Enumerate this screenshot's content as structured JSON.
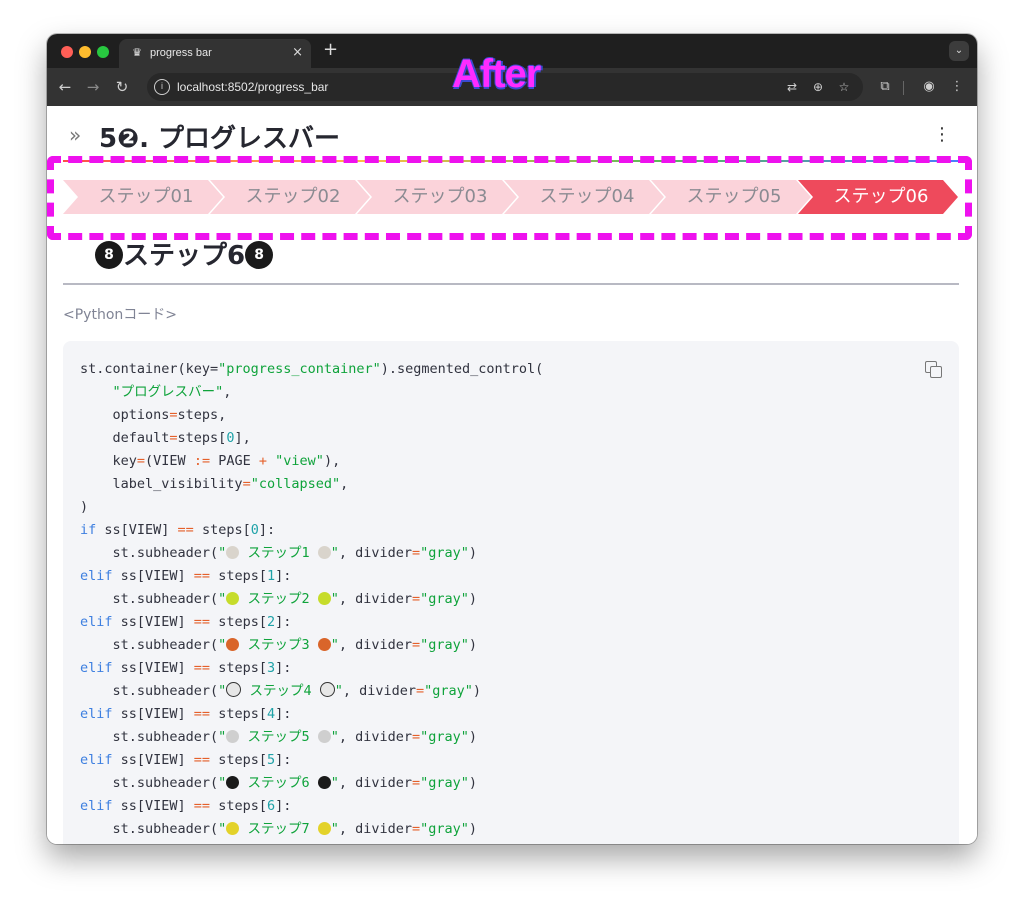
{
  "overlay": {
    "label": "After"
  },
  "browser": {
    "tab_title": "progress bar",
    "url": "localhost:8502/progress_bar"
  },
  "page": {
    "title": "5❷. プログレスバー",
    "steps": [
      "ステップ01",
      "ステップ02",
      "ステップ03",
      "ステップ04",
      "ステップ05",
      "ステップ06"
    ],
    "active_step_index": 5,
    "subheader_text": "ステップ6",
    "caption": "<Pythonコード>"
  },
  "code": {
    "lines": [
      "st.container(key=\"progress_container\").segmented_control(",
      "    \"プログレスバー\",",
      "    options=steps,",
      "    default=steps[0],",
      "    key=(VIEW := PAGE + \"view\"),",
      "    label_visibility=\"collapsed\",",
      ")",
      "if ss[VIEW] == steps[0]:",
      "    st.subheader(\"⚾ ステップ1 ⚾\", divider=\"gray\")",
      "elif ss[VIEW] == steps[1]:",
      "    st.subheader(\"🎾 ステップ2 🎾\", divider=\"gray\")",
      "elif ss[VIEW] == steps[2]:",
      "    st.subheader(\"🏀 ステップ3 🏀\", divider=\"gray\")",
      "elif ss[VIEW] == steps[3]:",
      "    st.subheader(\"⚽ ステップ4 ⚽\", divider=\"gray\")",
      "elif ss[VIEW] == steps[4]:",
      "    st.subheader(\"🏐 ステップ5 🏐\", divider=\"gray\")",
      "elif ss[VIEW] == steps[5]:",
      "    st.subheader(\"🎱 ステップ6 🎱\", divider=\"gray\")",
      "elif ss[VIEW] == steps[6]:",
      "    st.subheader(\"🥎 ステップ7 🥎\", divider=\"gray\")"
    ]
  },
  "colors": {
    "overlay_magenta": "#ff2bff",
    "step_inactive": "#fbd3da",
    "step_active": "#ee4a5c",
    "keyword": "#3d7fe0",
    "string": "#0fa33b",
    "operator": "#e5602a",
    "number": "#1fa2a8"
  }
}
